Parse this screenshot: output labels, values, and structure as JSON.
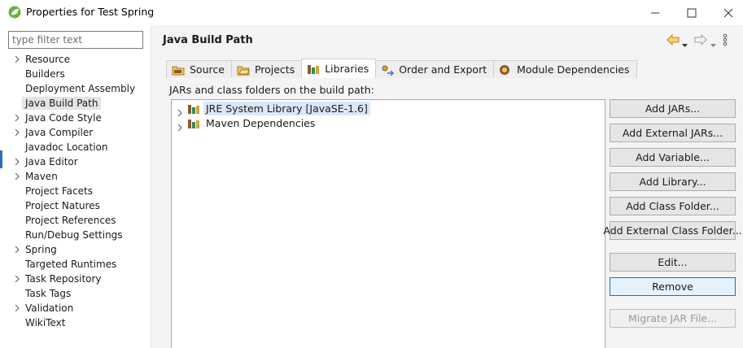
{
  "window": {
    "title": "Properties for Test Spring",
    "controls": {
      "minimize_icon": "minimize-icon",
      "maximize_icon": "maximize-icon",
      "close_icon": "close-icon"
    }
  },
  "sidebar": {
    "filter_placeholder": "type filter text",
    "items": [
      {
        "label": "Resource",
        "expandable": true,
        "selected": false
      },
      {
        "label": "Builders",
        "expandable": false,
        "selected": false
      },
      {
        "label": "Deployment Assembly",
        "expandable": false,
        "selected": false
      },
      {
        "label": "Java Build Path",
        "expandable": false,
        "selected": true
      },
      {
        "label": "Java Code Style",
        "expandable": true,
        "selected": false
      },
      {
        "label": "Java Compiler",
        "expandable": true,
        "selected": false
      },
      {
        "label": "Javadoc Location",
        "expandable": false,
        "selected": false
      },
      {
        "label": "Java Editor",
        "expandable": true,
        "selected": false
      },
      {
        "label": "Maven",
        "expandable": true,
        "selected": false
      },
      {
        "label": "Project Facets",
        "expandable": false,
        "selected": false
      },
      {
        "label": "Project Natures",
        "expandable": false,
        "selected": false
      },
      {
        "label": "Project References",
        "expandable": false,
        "selected": false
      },
      {
        "label": "Run/Debug Settings",
        "expandable": false,
        "selected": false
      },
      {
        "label": "Spring",
        "expandable": true,
        "selected": false
      },
      {
        "label": "Targeted Runtimes",
        "expandable": false,
        "selected": false
      },
      {
        "label": "Task Repository",
        "expandable": true,
        "selected": false
      },
      {
        "label": "Task Tags",
        "expandable": false,
        "selected": false
      },
      {
        "label": "Validation",
        "expandable": true,
        "selected": false
      },
      {
        "label": "WikiText",
        "expandable": false,
        "selected": false
      }
    ]
  },
  "main": {
    "title": "Java Build Path",
    "tabs": [
      {
        "label": "Source",
        "icon": "source-folder-icon",
        "active": false
      },
      {
        "label": "Projects",
        "icon": "projects-folder-icon",
        "active": false
      },
      {
        "label": "Libraries",
        "icon": "libraries-icon",
        "active": true
      },
      {
        "label": "Order and Export",
        "icon": "order-export-icon",
        "active": false
      },
      {
        "label": "Module Dependencies",
        "icon": "module-dependencies-icon",
        "active": false
      }
    ],
    "section_label": "JARs and class folders on the build path:",
    "libraries": [
      {
        "label": "JRE System Library [JavaSE-1.6]",
        "selected": true
      },
      {
        "label": "Maven Dependencies",
        "selected": false
      }
    ],
    "buttons": {
      "add_jars": "Add JARs...",
      "add_external_jars": "Add External JARs...",
      "add_variable": "Add Variable...",
      "add_library": "Add Library...",
      "add_class_folder": "Add Class Folder...",
      "add_external_class_folder": "Add External Class Folder...",
      "edit": "Edit...",
      "remove": "Remove",
      "migrate_jar": "Migrate JAR File..."
    }
  },
  "colors": {
    "accent": "#0078d7",
    "selection_tree": "#d9e8f9",
    "selection_sidebar": "#e4e4e4",
    "jar_green": "#2e8b57",
    "jar_brown": "#8a5a2b",
    "back_arrow": "#d9a21b"
  }
}
